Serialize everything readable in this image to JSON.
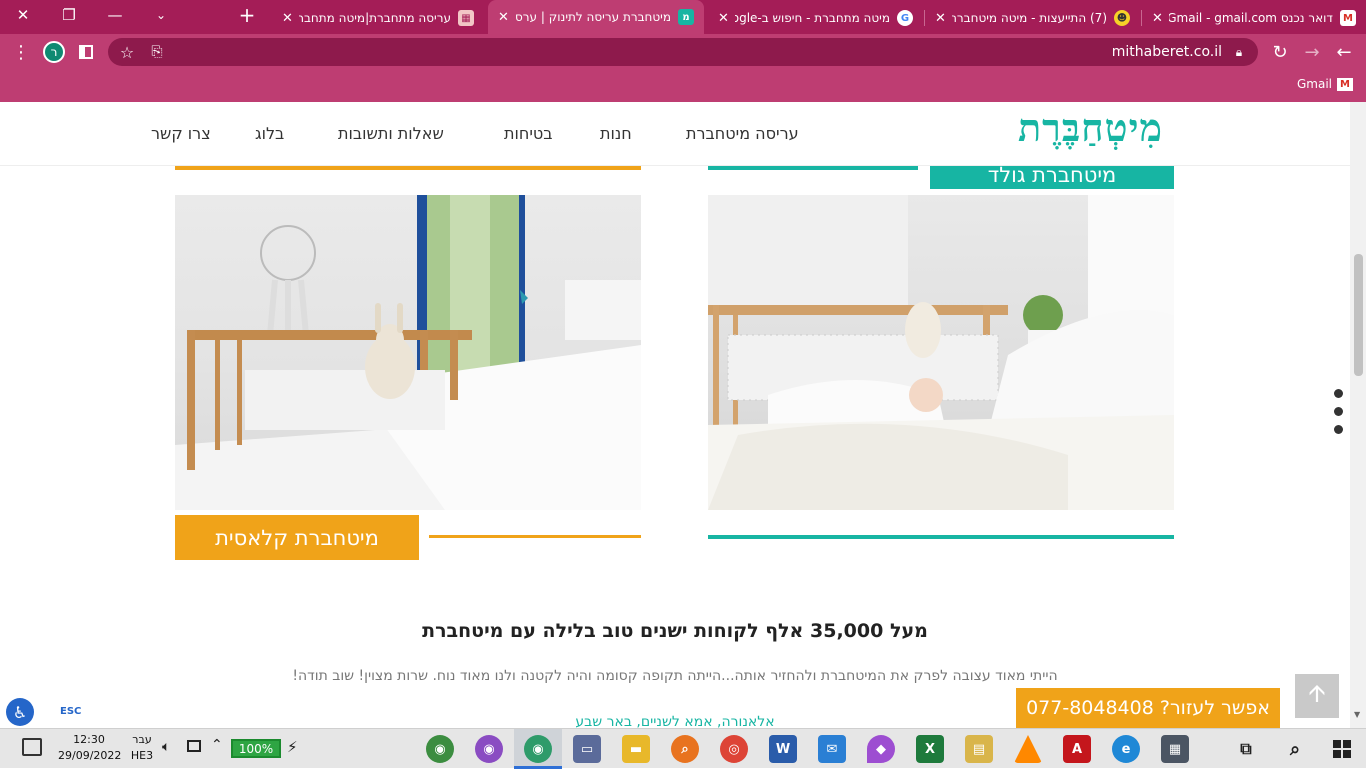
{
  "browser": {
    "tabs": [
      {
        "title": "דואר נכנס Gmail - gmail.com",
        "icon": "gmail-icon"
      },
      {
        "title": "(7) התייעצות - מיטה מיטחברת",
        "icon": "community-icon"
      },
      {
        "title": "מיטה מתחברת - חיפוש ב-Google",
        "icon": "google-icon"
      },
      {
        "title": "מיטחברת עריסה לתינוק | ערסל",
        "icon": "mitaberet-icon",
        "active": true
      },
      {
        "title": "עריסה מתחברת|מיטה מתחברת",
        "icon": "page-thumb-icon"
      }
    ],
    "new_tab": "+",
    "url": "mithaberet.co.il",
    "profile_initial": "ר",
    "bookmark": "Gmail"
  },
  "site": {
    "logo": "מִיטְחַבֶּרֶת",
    "nav": [
      "עריסה מיטחברת",
      "חנות",
      "בטיחות",
      "שאלות ותשובות",
      "בלוג",
      "צרו קשר"
    ],
    "product_top": "מיטחברת גולד",
    "product_classic": "מיטחברת קלאסית",
    "headline": "מעל 35,000 אלף לקוחות ישנים טוב בלילה עם מיטחברת",
    "testimonial": "הייתי מאוד עצובה לפרק את המיטחברת ולהחזיר אותה...הייתה תקופה קסומה והיה לקטנה ולנו מאוד נוח. שרות מצוין! שוב תודה!",
    "testimonial_author": "אלאנורה, אמא לשניים, באר שבע",
    "help_banner": "אפשר לעזור? 077-8048408",
    "esc": "ESC",
    "colors": {
      "brand": "#17b5a3",
      "accent": "#f0a319",
      "chrome": "#a41d57"
    }
  },
  "taskbar": {
    "time": "12:30",
    "date": "29/09/2022",
    "lang_top": "עבר",
    "lang_bottom": "HE3",
    "battery": "100%"
  }
}
